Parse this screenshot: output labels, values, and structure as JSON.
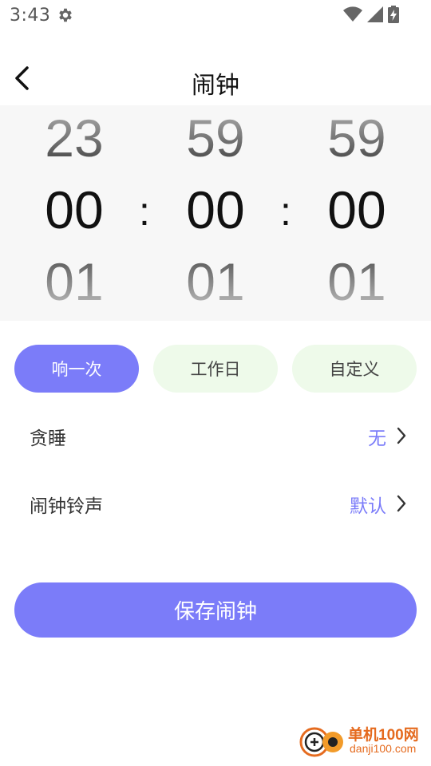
{
  "status_bar": {
    "time": "3:43",
    "icons": [
      "settings-icon",
      "wifi-icon",
      "signal-icon",
      "battery-charging-icon"
    ]
  },
  "header": {
    "title": "闹钟",
    "back_icon": "chevron-left-icon"
  },
  "picker": {
    "hours": {
      "prev": "23",
      "selected": "00",
      "next": "01"
    },
    "minutes": {
      "prev": "59",
      "selected": "00",
      "next": "01"
    },
    "seconds": {
      "prev": "59",
      "selected": "00",
      "next": "01"
    },
    "separator": ":"
  },
  "repeat_options": [
    {
      "label": "响一次",
      "selected": true
    },
    {
      "label": "工作日",
      "selected": false
    },
    {
      "label": "自定义",
      "selected": false
    }
  ],
  "settings": {
    "snooze": {
      "label": "贪睡",
      "value": "无"
    },
    "ringtone": {
      "label": "闹钟铃声",
      "value": "默认"
    }
  },
  "save_label": "保存闹钟",
  "colors": {
    "accent": "#7b7cf9",
    "pill_inactive_bg": "#eefaea",
    "picker_bg": "#f7f7f7"
  },
  "watermark": {
    "name": "单机100网",
    "domain": "danji100.com"
  }
}
